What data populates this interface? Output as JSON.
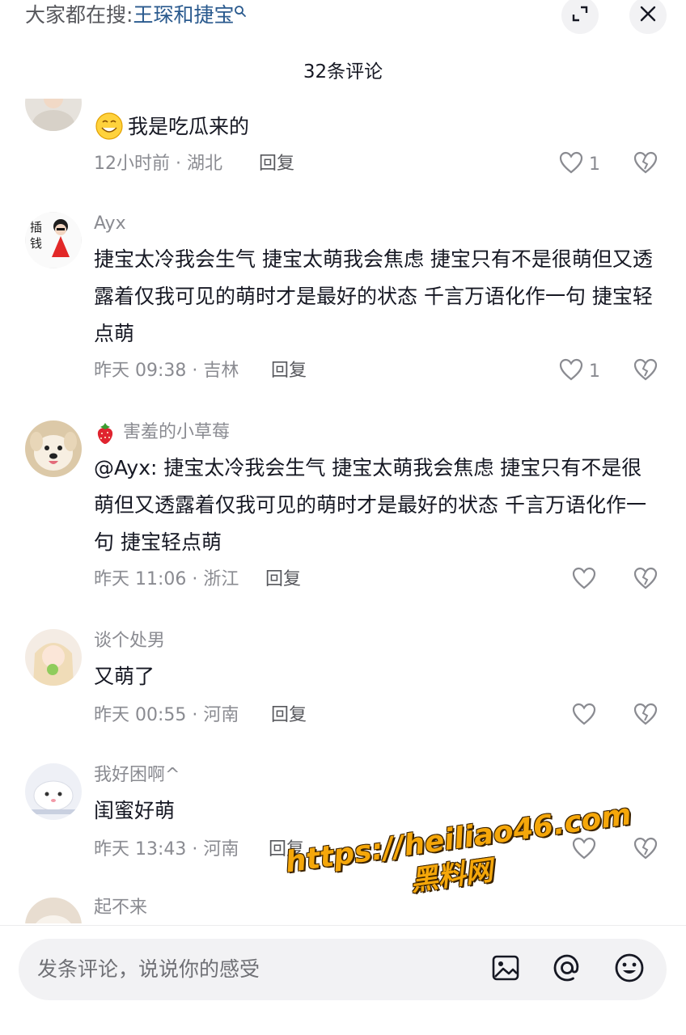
{
  "header": {
    "search_prefix": "大家都在搜:",
    "search_keyword": "王琛和捷宝",
    "comment_count": "32条评论"
  },
  "comments": [
    {
      "username": "",
      "text": "我是吃瓜来的",
      "meta": "12小时前 · 湖北",
      "reply": "回复",
      "likes": "1"
    },
    {
      "username": "Ayx",
      "text": "捷宝太冷我会生气 捷宝太萌我会焦虑 捷宝只有不是很萌但又透露着仅我可见的萌时才是最好的状态 千言万语化作一句 捷宝轻点萌",
      "meta": "昨天 09:38 · 吉林",
      "reply": "回复",
      "likes": "1"
    },
    {
      "username": "害羞的小草莓",
      "text": "@Ayx: 捷宝太冷我会生气 捷宝太萌我会焦虑 捷宝只有不是很萌但又透露着仅我可见的萌时才是最好的状态 千言万语化作一句 捷宝轻点萌",
      "meta": "昨天 11:06 · 浙江",
      "reply": "回复",
      "likes": ""
    },
    {
      "username": "谈个处男",
      "text": "又萌了",
      "meta": "昨天 00:55 · 河南",
      "reply": "回复",
      "likes": ""
    },
    {
      "username": "我好困啊^",
      "text": "闺蜜好萌",
      "meta": "昨天 13:43 · 河南",
      "reply": "回复",
      "likes": ""
    },
    {
      "username": "起不来",
      "text": "",
      "meta": "",
      "reply": "",
      "likes": ""
    }
  ],
  "input": {
    "placeholder": "发条评论，说说你的感受"
  },
  "watermark": {
    "url": "https://heiliao46.com",
    "name": "黑料网"
  },
  "icons": {
    "search": "search-icon",
    "expand": "expand-icon",
    "close": "close-icon",
    "like": "heart-icon",
    "dislike": "broken-heart-icon",
    "image": "image-icon",
    "mention": "at-icon",
    "emoji": "emoji-icon"
  },
  "colors": {
    "keyword": "#2a5a8e",
    "meta_text": "#8a8b91",
    "watermark": "#f5a70a"
  }
}
